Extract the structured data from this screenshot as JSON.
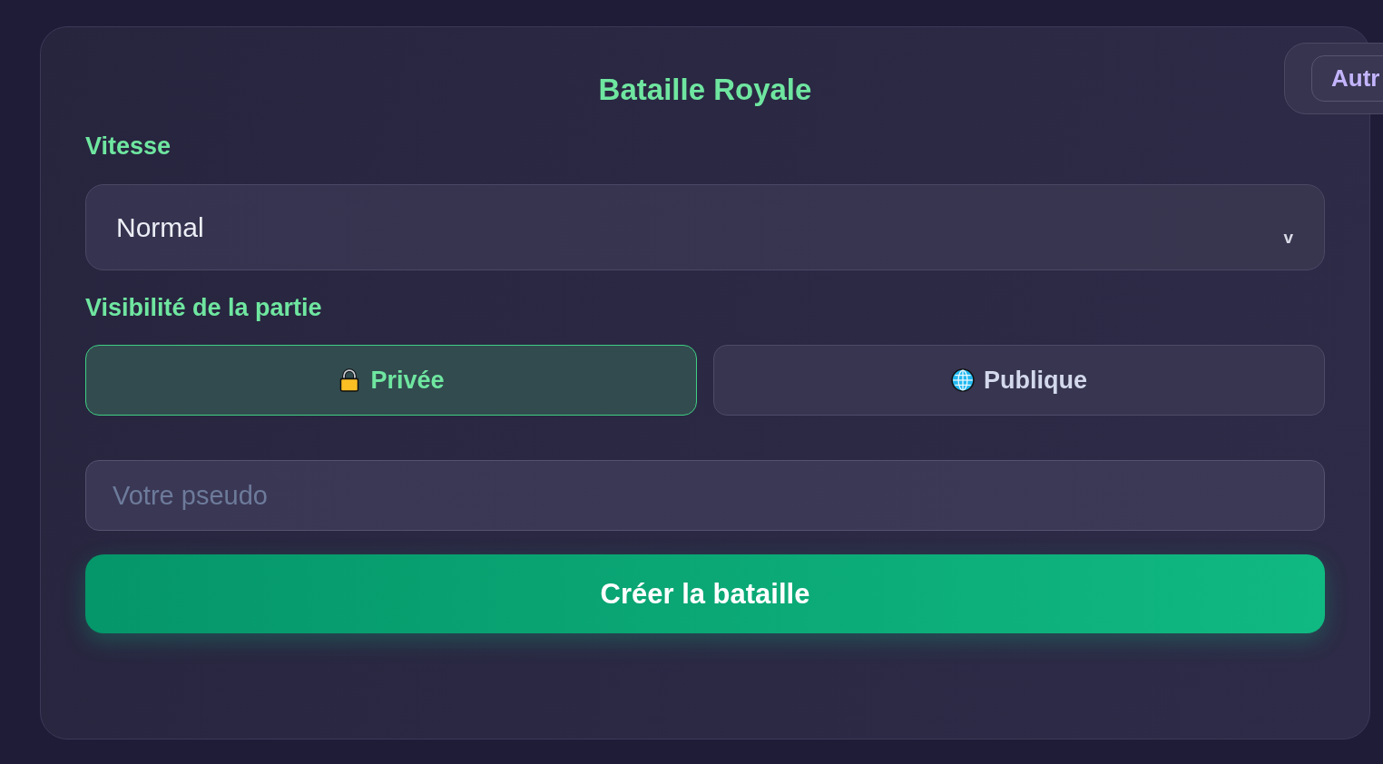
{
  "title": "Bataille Royale",
  "corner_panel": {
    "button_label": "Autr"
  },
  "speed": {
    "label": "Vitesse",
    "value": "Normal",
    "caret": "v"
  },
  "visibility": {
    "label": "Visibilité de la partie",
    "options": [
      {
        "kind": "private",
        "label": "Privée",
        "selected": true
      },
      {
        "kind": "public",
        "label": "Publique",
        "selected": false
      }
    ]
  },
  "nickname": {
    "placeholder": "Votre pseudo"
  },
  "submit": {
    "label": "Créer la bataille"
  }
}
